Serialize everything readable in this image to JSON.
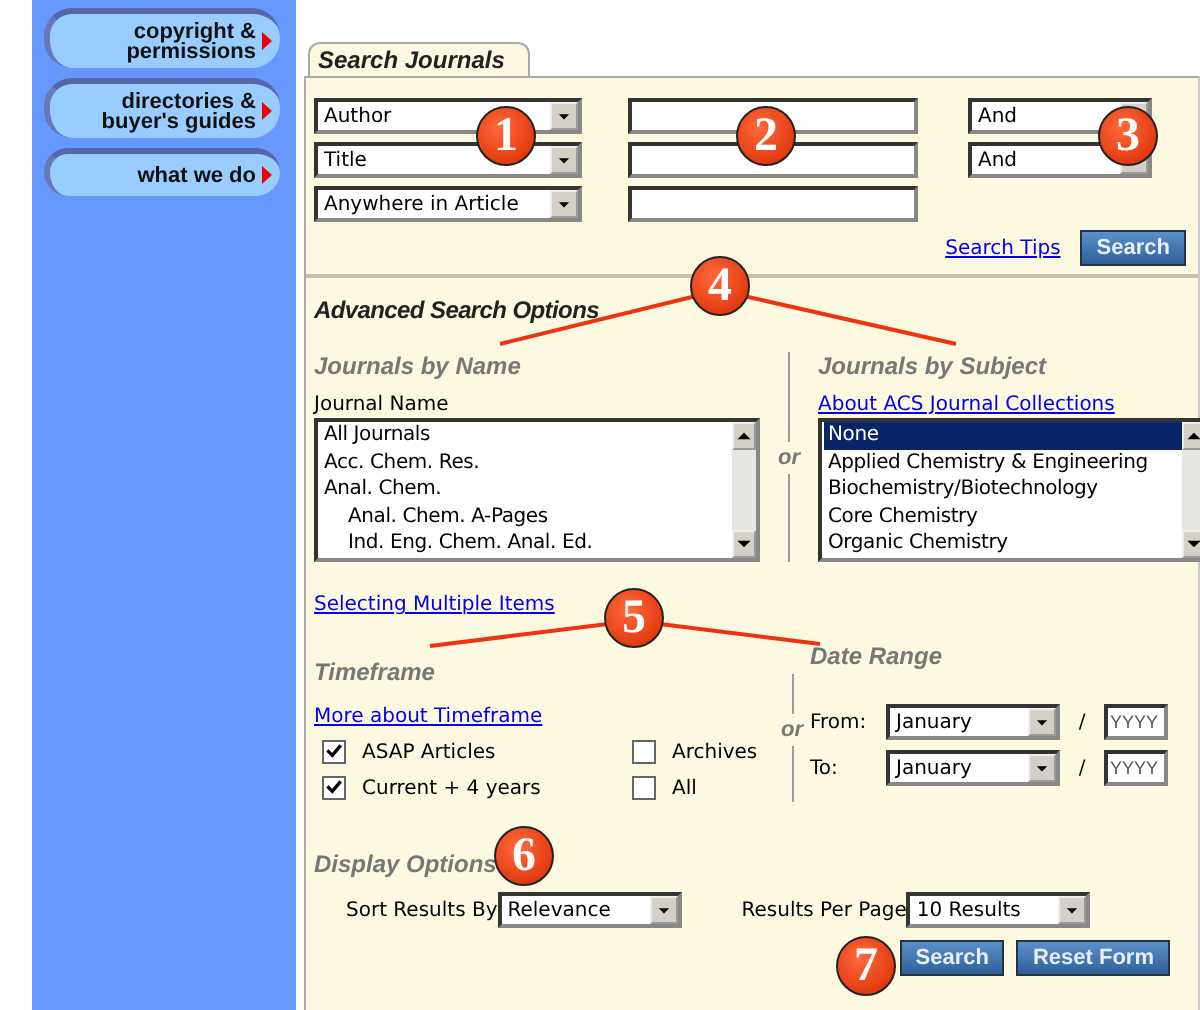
{
  "sidebar": {
    "items": [
      {
        "lines": [
          "copyright &",
          "permissions"
        ]
      },
      {
        "lines": [
          "directories &",
          "buyer's guides"
        ]
      },
      {
        "lines": [
          "what we do"
        ]
      }
    ]
  },
  "tab": {
    "label": "Search Journals",
    "selected": true
  },
  "search_rows": [
    {
      "field": "Author",
      "operator": "And"
    },
    {
      "field": "Title",
      "operator": "And"
    },
    {
      "field": "Anywhere in Article"
    }
  ],
  "search_tips": "Search Tips",
  "search_button": "Search",
  "advanced": {
    "title": "Advanced Search Options",
    "by_name": {
      "heading": "Journals by Name",
      "label": "Journal Name",
      "items": [
        {
          "label": "All Journals",
          "selected": false
        },
        {
          "label": "Acc. Chem. Res.",
          "selected": false
        },
        {
          "label": "Anal. Chem.",
          "selected": false,
          "children": [
            {
              "label": "Anal. Chem. A-Pages",
              "selected": false
            },
            {
              "label": "Ind. Eng. Chem. Anal. Ed.",
              "selected": false
            }
          ]
        }
      ]
    },
    "or_1": "or",
    "by_subject": {
      "heading": "Journals by Subject",
      "link": "About ACS Journal Collections",
      "items": [
        {
          "label": "None",
          "selected": true
        },
        {
          "label": "Applied Chemistry & Engineering",
          "selected": false
        },
        {
          "label": "Biochemistry/Biotechnology",
          "selected": false
        },
        {
          "label": "Core Chemistry",
          "selected": false
        },
        {
          "label": "Organic Chemistry",
          "selected": false
        }
      ]
    },
    "multi_link": "Selecting Multiple Items"
  },
  "timeframe": {
    "heading": "Timeframe",
    "link": "More about Timeframe",
    "options": [
      {
        "label": "ASAP Articles",
        "checked": true
      },
      {
        "label": "Archives",
        "checked": false
      },
      {
        "label": "Current + 4 years",
        "checked": true
      },
      {
        "label": "All",
        "checked": false
      }
    ]
  },
  "or_2": "or",
  "date_range": {
    "heading": "Date Range",
    "rows": [
      {
        "label": "From:",
        "month": "January",
        "separator": "/",
        "placeholder": "YYYY"
      },
      {
        "label": "To:",
        "month": "January",
        "separator": "/",
        "placeholder": "YYYY"
      }
    ]
  },
  "display": {
    "heading": "Display Options",
    "sort_label": "Sort Results By",
    "sort_value": "Relevance",
    "per_page_label": "Results Per Page",
    "per_page_value": "10 Results"
  },
  "buttons": [
    "Search",
    "Reset Form"
  ],
  "callouts": [
    "1",
    "2",
    "3",
    "4",
    "5",
    "6",
    "7"
  ]
}
